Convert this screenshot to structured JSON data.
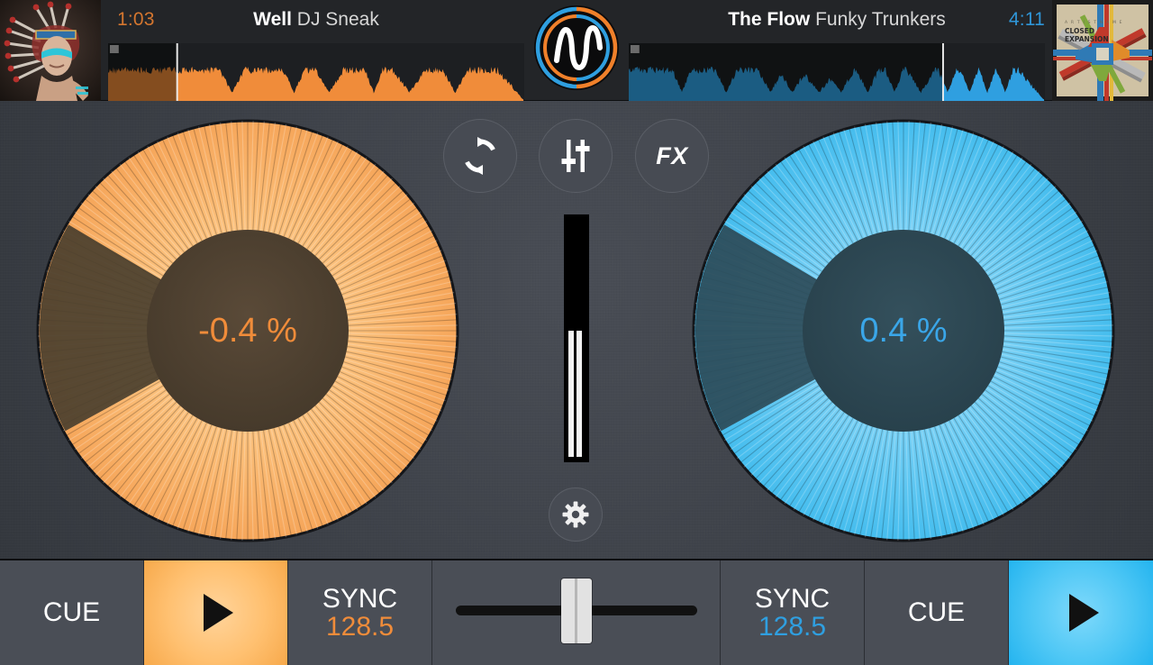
{
  "app": {
    "logo_name": "waveform-logo",
    "accent_left": "#f08c3a",
    "accent_right": "#2f9fe0",
    "background": "#3f434a"
  },
  "decks": {
    "left": {
      "elapsed_time": "1:03",
      "track_title": "Well",
      "track_artist": "DJ Sneak",
      "pitch": "-0.4 %",
      "bpm": "128.5",
      "sync_label": "SYNC",
      "cue_label": "CUE",
      "play_icon": "play-triangle-icon",
      "album_art": "native-american-headdress-portrait",
      "waveform_progress": 0.165,
      "platter_progress": 0.165,
      "color": "#f08c3a",
      "color_dim": "#d4762f"
    },
    "right": {
      "elapsed_time": "4:11",
      "track_title": "The Flow",
      "track_artist": "Funky Trunkers",
      "pitch": "0.4 %",
      "bpm": "128.5",
      "sync_label": "SYNC",
      "cue_label": "CUE",
      "play_icon": "play-triangle-icon",
      "album_art": "closed-expansion-abstract-cover",
      "album_art_title": "CLOSED",
      "album_art_subtitle": "EXPANSION",
      "waveform_progress": 0.755,
      "platter_progress": 0.165,
      "color": "#2f9fe0",
      "color_dim": "#1f6f9e"
    }
  },
  "center": {
    "buttons": [
      {
        "id": "loop",
        "icon": "loop-repeat-icon",
        "label": ""
      },
      {
        "id": "eq",
        "icon": "eq-sliders-icon",
        "label": ""
      },
      {
        "id": "fx",
        "icon": "fx-icon",
        "label": "FX"
      }
    ],
    "settings": {
      "icon": "gear-icon"
    },
    "vertical_fader": {
      "name": "center-vertical-fader",
      "value": 0.5
    },
    "crossfader": {
      "name": "crossfader",
      "value": 0.5
    }
  }
}
